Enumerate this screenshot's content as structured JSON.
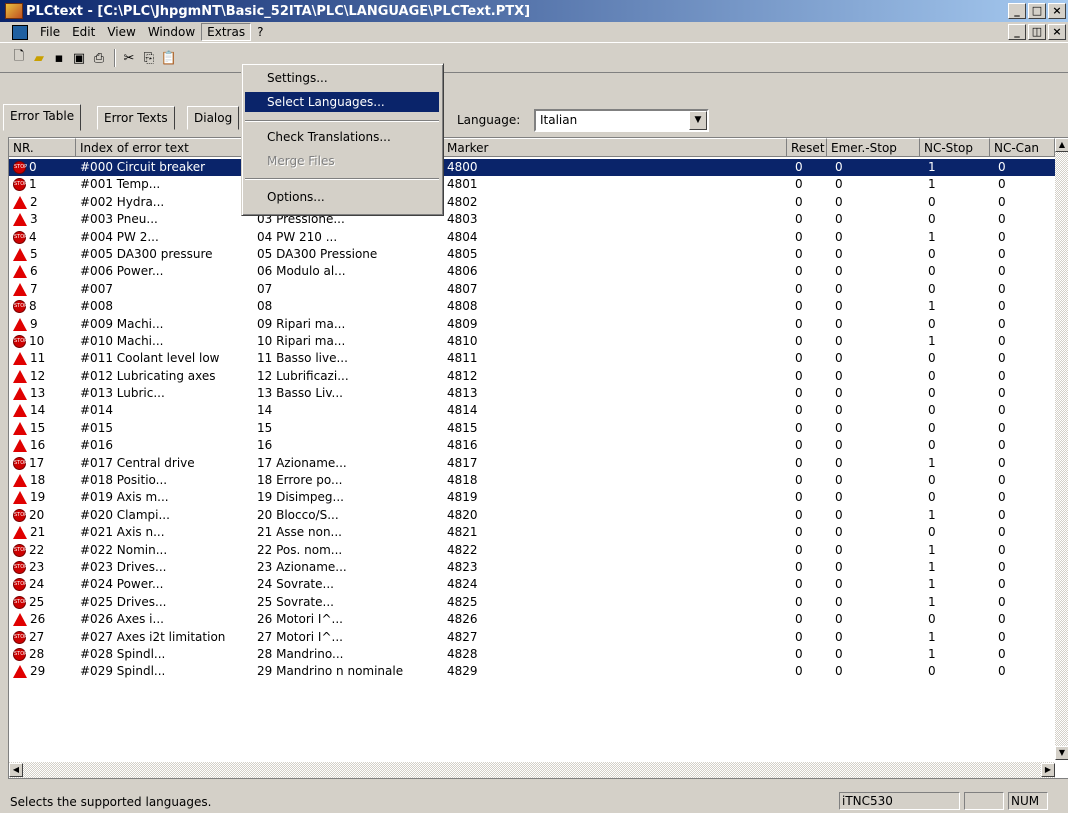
{
  "window": {
    "title": "PLCtext - [C:\\PLC\\JhpgmNT\\Basic_52ITA\\PLC\\LANGUAGE\\PLCText.PTX]"
  },
  "menu": [
    "File",
    "Edit",
    "View",
    "Window",
    "Extras",
    "?"
  ],
  "extras_menu": {
    "items": [
      "Settings...",
      "Select Languages...",
      "Check Translations...",
      "Merge Files",
      "Options..."
    ],
    "highlighted": "Select Languages...",
    "disabled": "Merge Files"
  },
  "tabs": [
    "Error Table",
    "Error Texts",
    "Dialog"
  ],
  "language": {
    "label": "Language:",
    "value": "Italian"
  },
  "columns": [
    "NR.",
    "Index of error text",
    "",
    "Marker",
    "Reset",
    "Emer.-Stop",
    "NC-Stop",
    "NC-Can"
  ],
  "rows": [
    {
      "nr": "0",
      "icon": "stop",
      "idx": "#000 Circuit breaker",
      "txt": "",
      "marker": "4800",
      "reset": "0",
      "emer": "0",
      "ncstop": "1",
      "nccan": "0"
    },
    {
      "nr": "1",
      "icon": "stop",
      "idx": "#001 Temp...",
      "txt": "",
      "marker": "4801",
      "reset": "0",
      "emer": "0",
      "ncstop": "1",
      "nccan": "0"
    },
    {
      "nr": "2",
      "icon": "warn",
      "idx": "#002 Hydra...",
      "txt": "",
      "marker": "4802",
      "reset": "0",
      "emer": "0",
      "ncstop": "0",
      "nccan": "0"
    },
    {
      "nr": "3",
      "icon": "warn",
      "idx": "#003 Pneu...",
      "txt": "03 Pressione...",
      "marker": "4803",
      "reset": "0",
      "emer": "0",
      "ncstop": "0",
      "nccan": "0"
    },
    {
      "nr": "4",
      "icon": "stop",
      "idx": "#004 PW 2...",
      "txt": "04 PW 210 ...",
      "marker": "4804",
      "reset": "0",
      "emer": "0",
      "ncstop": "1",
      "nccan": "0"
    },
    {
      "nr": "5",
      "icon": "warn",
      "idx": "#005 DA300 pressure",
      "txt": "05 DA300 Pressione",
      "marker": "4805",
      "reset": "0",
      "emer": "0",
      "ncstop": "0",
      "nccan": "0"
    },
    {
      "nr": "6",
      "icon": "warn",
      "idx": "#006 Power...",
      "txt": "06 Modulo al...",
      "marker": "4806",
      "reset": "0",
      "emer": "0",
      "ncstop": "0",
      "nccan": "0"
    },
    {
      "nr": "7",
      "icon": "warn",
      "idx": "#007",
      "txt": "07",
      "marker": "4807",
      "reset": "0",
      "emer": "0",
      "ncstop": "0",
      "nccan": "0"
    },
    {
      "nr": "8",
      "icon": "stop",
      "idx": "#008",
      "txt": "08",
      "marker": "4808",
      "reset": "0",
      "emer": "0",
      "ncstop": "1",
      "nccan": "0"
    },
    {
      "nr": "9",
      "icon": "warn",
      "idx": "#009 Machi...",
      "txt": "09 Ripari ma...",
      "marker": "4809",
      "reset": "0",
      "emer": "0",
      "ncstop": "0",
      "nccan": "0"
    },
    {
      "nr": "10",
      "icon": "stop",
      "idx": "#010 Machi...",
      "txt": "10 Ripari ma...",
      "marker": "4810",
      "reset": "0",
      "emer": "0",
      "ncstop": "1",
      "nccan": "0"
    },
    {
      "nr": "11",
      "icon": "warn",
      "idx": "#011 Coolant level low",
      "txt": "11 Basso live...",
      "marker": "4811",
      "reset": "0",
      "emer": "0",
      "ncstop": "0",
      "nccan": "0"
    },
    {
      "nr": "12",
      "icon": "warn",
      "idx": "#012 Lubricating axes",
      "txt": "12 Lubrificazi...",
      "marker": "4812",
      "reset": "0",
      "emer": "0",
      "ncstop": "0",
      "nccan": "0"
    },
    {
      "nr": "13",
      "icon": "warn",
      "idx": "#013 Lubric...",
      "txt": "13 Basso Liv...",
      "marker": "4813",
      "reset": "0",
      "emer": "0",
      "ncstop": "0",
      "nccan": "0"
    },
    {
      "nr": "14",
      "icon": "warn",
      "idx": "#014",
      "txt": "14",
      "marker": "4814",
      "reset": "0",
      "emer": "0",
      "ncstop": "0",
      "nccan": "0"
    },
    {
      "nr": "15",
      "icon": "warn",
      "idx": "#015",
      "txt": "15",
      "marker": "4815",
      "reset": "0",
      "emer": "0",
      "ncstop": "0",
      "nccan": "0"
    },
    {
      "nr": "16",
      "icon": "warn",
      "idx": "#016",
      "txt": "16",
      "marker": "4816",
      "reset": "0",
      "emer": "0",
      "ncstop": "0",
      "nccan": "0"
    },
    {
      "nr": "17",
      "icon": "stop",
      "idx": "#017 Central drive",
      "txt": "17 Azioname...",
      "marker": "4817",
      "reset": "0",
      "emer": "0",
      "ncstop": "1",
      "nccan": "0"
    },
    {
      "nr": "18",
      "icon": "warn",
      "idx": "#018 Positio...",
      "txt": "18 Errore po...",
      "marker": "4818",
      "reset": "0",
      "emer": "0",
      "ncstop": "0",
      "nccan": "0"
    },
    {
      "nr": "19",
      "icon": "warn",
      "idx": "#019 Axis m...",
      "txt": "19 Disimpeg...",
      "marker": "4819",
      "reset": "0",
      "emer": "0",
      "ncstop": "0",
      "nccan": "0"
    },
    {
      "nr": "20",
      "icon": "stop",
      "idx": "#020 Clampi...",
      "txt": "20 Blocco/S...",
      "marker": "4820",
      "reset": "0",
      "emer": "0",
      "ncstop": "1",
      "nccan": "0"
    },
    {
      "nr": "21",
      "icon": "warn",
      "idx": "#021 Axis n...",
      "txt": "21 Asse non...",
      "marker": "4821",
      "reset": "0",
      "emer": "0",
      "ncstop": "0",
      "nccan": "0"
    },
    {
      "nr": "22",
      "icon": "stop",
      "idx": "#022 Nomin...",
      "txt": "22 Pos. nom...",
      "marker": "4822",
      "reset": "0",
      "emer": "0",
      "ncstop": "1",
      "nccan": "0"
    },
    {
      "nr": "23",
      "icon": "stop",
      "idx": "#023 Drives...",
      "txt": "23 Azioname...",
      "marker": "4823",
      "reset": "0",
      "emer": "0",
      "ncstop": "1",
      "nccan": "0"
    },
    {
      "nr": "24",
      "icon": "stop",
      "idx": "#024 Power...",
      "txt": "24 Sovrate...",
      "marker": "4824",
      "reset": "0",
      "emer": "0",
      "ncstop": "1",
      "nccan": "0"
    },
    {
      "nr": "25",
      "icon": "stop",
      "idx": "#025 Drives...",
      "txt": "25 Sovrate...",
      "marker": "4825",
      "reset": "0",
      "emer": "0",
      "ncstop": "1",
      "nccan": "0"
    },
    {
      "nr": "26",
      "icon": "warn",
      "idx": "#026 Axes i...",
      "txt": "26 Motori I^...",
      "marker": "4826",
      "reset": "0",
      "emer": "0",
      "ncstop": "0",
      "nccan": "0"
    },
    {
      "nr": "27",
      "icon": "stop",
      "idx": "#027 Axes i2t limitation",
      "txt": "27 Motori I^...",
      "marker": "4827",
      "reset": "0",
      "emer": "0",
      "ncstop": "1",
      "nccan": "0"
    },
    {
      "nr": "28",
      "icon": "stop",
      "idx": "#028 Spindl...",
      "txt": "28 Mandrino...",
      "marker": "4828",
      "reset": "0",
      "emer": "0",
      "ncstop": "1",
      "nccan": "0"
    },
    {
      "nr": "29",
      "icon": "warn",
      "idx": "#029 Spindl...",
      "txt": "29 Mandrino n nominale",
      "marker": "4829",
      "reset": "0",
      "emer": "0",
      "ncstop": "0",
      "nccan": "0"
    }
  ],
  "status": {
    "text": "Selects the supported languages.",
    "panel1": "iTNC530",
    "panel3": "NUM"
  }
}
